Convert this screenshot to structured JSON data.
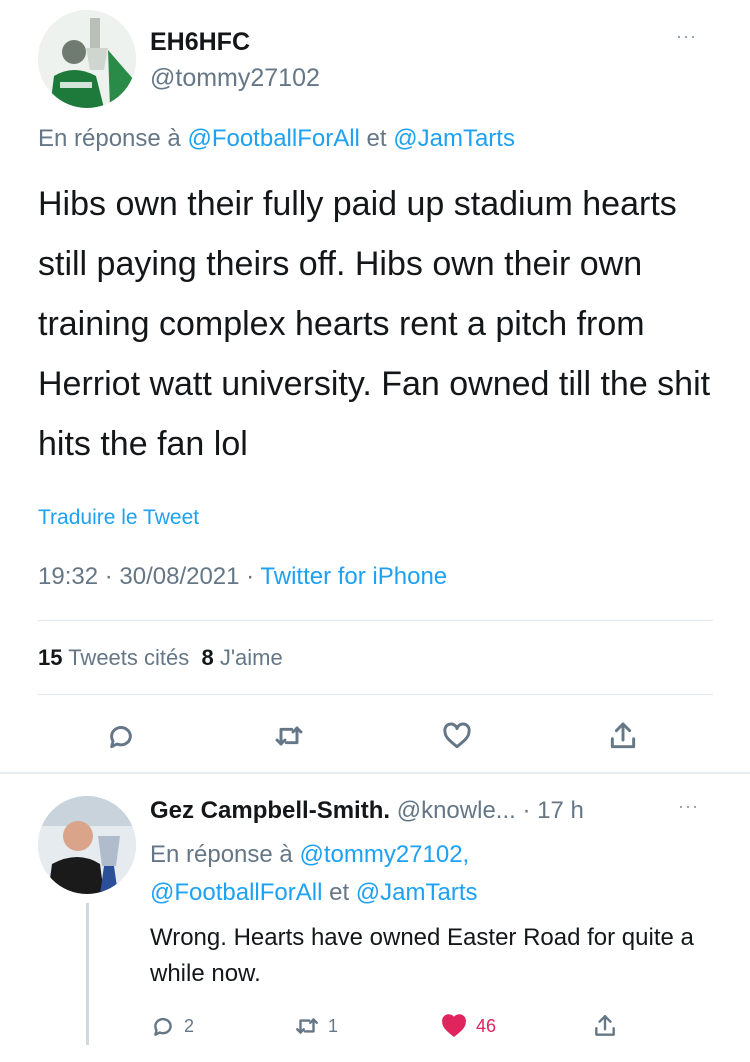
{
  "tweet": {
    "author_name": "EH6HFC",
    "author_handle": "@tommy27102",
    "more_icon": "···",
    "reply_prefix": "En réponse à",
    "reply_mention_1": "@FootballForAll",
    "reply_conj": "et",
    "reply_mention_2": "@JamTarts",
    "text": "Hibs own their fully paid up stadium hearts still paying theirs off. Hibs own their own training complex hearts rent a pitch from Herriot watt university. Fan owned till the shit hits the fan lol",
    "translate": "Traduire le Tweet",
    "time": "19:32 · 30/08/2021 · ",
    "source": "Twitter for iPhone",
    "quote_count": "15",
    "quote_label": "Tweets cités",
    "like_count": "8",
    "like_label": "J'aime",
    "actions": [
      "reply-icon",
      "retweet-icon",
      "like-icon",
      "share-icon"
    ]
  },
  "reply": {
    "author_name": "Gez Campbell-Smith.",
    "author_handle": "@knowle...",
    "time": "· 17 h",
    "more_icon": "···",
    "reply_prefix": "En réponse à",
    "reply_mention_1": "@tommy27102,",
    "reply_mention_2": "@FootballForAll",
    "reply_conj": "et",
    "reply_mention_3": "@JamTarts",
    "text": "Wrong.  Hearts have owned Easter Road for quite a while now.",
    "reply_count": "2",
    "retweet_count": "1",
    "like_count": "46"
  },
  "colors": {
    "link": "#1da1f2",
    "secondary": "#657786",
    "like": "#e0245e"
  }
}
